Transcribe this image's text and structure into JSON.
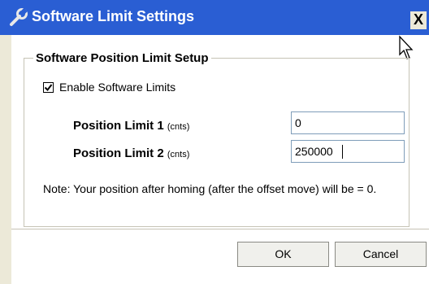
{
  "window": {
    "title": "Software Limit Settings",
    "close_glyph": "X",
    "icon": "wrench-icon"
  },
  "group": {
    "title": "Software Position Limit Setup"
  },
  "enable_limits": {
    "label": "Enable Software Limits",
    "checked": true
  },
  "limit1": {
    "label": "Position Limit 1",
    "unit": "(cnts)",
    "value": "0"
  },
  "limit2": {
    "label": "Position Limit 2",
    "unit": "(cnts)",
    "value": "250000"
  },
  "note": "Note: Your position after homing (after the offset move) will be = 0.",
  "buttons": {
    "ok": "OK",
    "cancel": "Cancel"
  },
  "colors": {
    "titlebar": "#2a5ed3",
    "background": "#ffffff",
    "frame": "#ece9d8"
  }
}
